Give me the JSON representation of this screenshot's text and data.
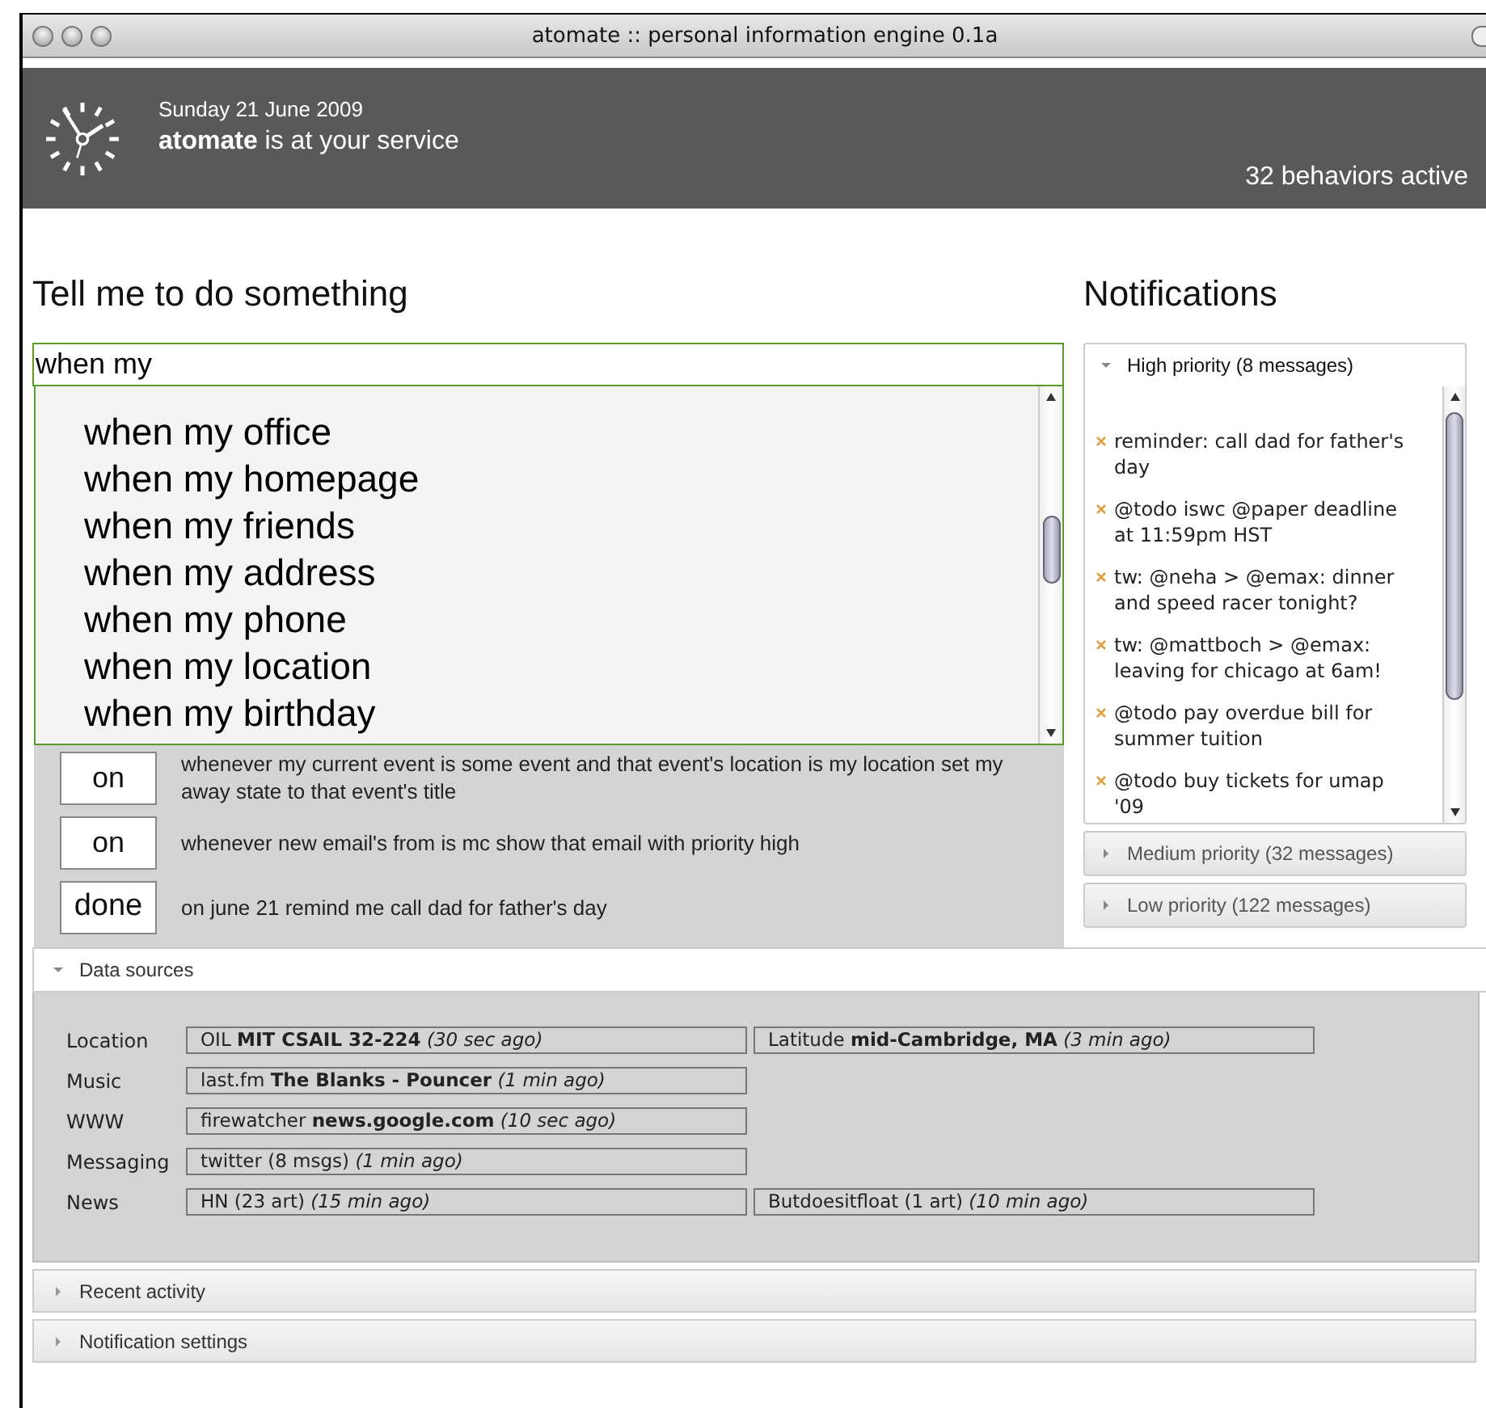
{
  "window": {
    "title": "atomate :: personal information engine 0.1a"
  },
  "header": {
    "date": "Sunday 21 June 2009",
    "greeting": "**atomate** is at your service",
    "status": "32 behaviors active"
  },
  "command": {
    "heading": "Tell me to do something",
    "value": "when my ",
    "suggestions": [
      "when my office",
      "when my homepage",
      "when my friends",
      "when my address",
      "when my phone",
      "when my location",
      "when my birthday"
    ]
  },
  "behaviors": [
    {
      "state": "on",
      "text": "whenever my current event is some event and that event's location is my location set my away state to that event's title"
    },
    {
      "state": "on",
      "text": "whenever new email's from is mc show that email with priority high"
    },
    {
      "state": "done",
      "text": "on june 21 remind me call dad for father's day"
    }
  ],
  "notifications": {
    "heading": "Notifications",
    "groups": [
      {
        "label": "High priority (8 messages)",
        "expanded": true,
        "items": [
          "reminder: call dad for father's day",
          "@todo iswc @paper deadline at 11:59pm HST",
          "tw: @neha > @emax: dinner and speed racer tonight?",
          "tw: @mattboch > @emax: leaving for chicago at 6am!",
          "@todo pay overdue bill for summer tuition",
          "@todo buy tickets for umap '09"
        ]
      },
      {
        "label": "Medium priority (32 messages)",
        "expanded": false
      },
      {
        "label": "Low priority (122 messages)",
        "expanded": false
      }
    ]
  },
  "data_sources": {
    "label": "Data sources",
    "expanded": true,
    "rows": [
      {
        "label": "Location",
        "values": [
          "OIL **MIT CSAIL 32-224** *(30 sec ago)*",
          "Latitude **mid-Cambridge, MA** *(3 min ago)*"
        ]
      },
      {
        "label": "Music",
        "values": [
          "last.fm **The Blanks - Pouncer** *(1 min ago)*"
        ]
      },
      {
        "label": "WWW",
        "values": [
          "firewatcher **news.google.com** *(10 sec ago)*"
        ]
      },
      {
        "label": "Messaging",
        "values": [
          "twitter (8 msgs) *(1 min ago)*"
        ]
      },
      {
        "label": "News",
        "values": [
          "HN (23 art) *(15 min ago)*",
          "Butdoesitfloat (1 art) *(10 min ago)*"
        ]
      }
    ]
  },
  "sections": [
    {
      "label": "Recent activity",
      "expanded": false
    },
    {
      "label": "Notification settings",
      "expanded": false
    }
  ]
}
